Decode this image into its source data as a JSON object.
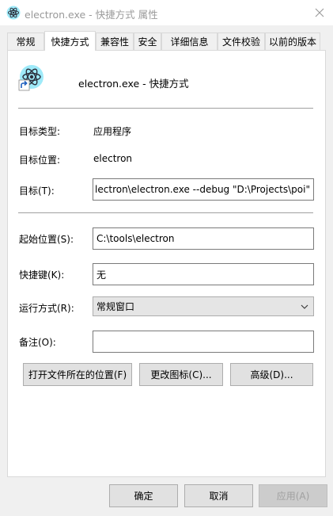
{
  "window": {
    "title": "electron.exe - 快捷方式 属性",
    "icon": "electron-app-icon",
    "close_icon": "close-icon"
  },
  "tabs": [
    {
      "label": "常规",
      "active": false
    },
    {
      "label": "快捷方式",
      "active": true
    },
    {
      "label": "兼容性",
      "active": false
    },
    {
      "label": "安全",
      "active": false
    },
    {
      "label": "详细信息",
      "active": false
    },
    {
      "label": "文件校验",
      "active": false
    },
    {
      "label": "以前的版本",
      "active": false
    }
  ],
  "shortcut": {
    "name": "electron.exe - 快捷方式",
    "icon": "electron-shortcut-icon",
    "target_type_label": "目标类型:",
    "target_type_value": "应用程序",
    "target_location_label": "目标位置:",
    "target_location_value": "electron",
    "target_label": "目标(T):",
    "target_value": "lectron\\electron.exe --debug \"D:\\Projects\\poi\"",
    "start_in_label": "起始位置(S):",
    "start_in_value": "C:\\tools\\electron",
    "hotkey_label": "快捷键(K):",
    "hotkey_value": "无",
    "run_label": "运行方式(R):",
    "run_value": "常规窗口",
    "comment_label": "备注(O):",
    "comment_value": ""
  },
  "buttons": {
    "open_location": "打开文件所在的位置(F)",
    "change_icon": "更改图标(C)...",
    "advanced": "高级(D)..."
  },
  "dialog_buttons": {
    "ok": "确定",
    "cancel": "取消",
    "apply": "应用(A)"
  },
  "colors": {
    "accent": "#47848f",
    "disabled_text": "#a0a0a0"
  }
}
